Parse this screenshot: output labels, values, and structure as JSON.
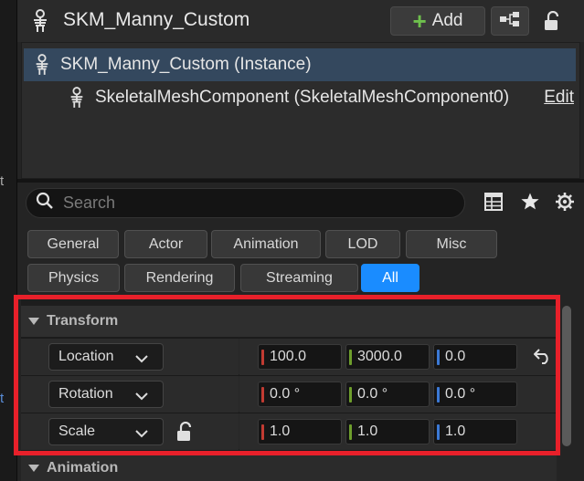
{
  "header": {
    "title": "SKM_Manny_Custom",
    "add_label": "Add",
    "icons": {
      "actor": "skeleton-icon",
      "add": "plus-icon",
      "tree": "hierarchy-icon",
      "lock": "unlock-icon"
    }
  },
  "tree": {
    "root_label": "SKM_Manny_Custom (Instance)",
    "child_label": "SkeletalMeshComponent (SkeletalMeshComponent0)",
    "edit_label": "Edit"
  },
  "search": {
    "placeholder": "Search"
  },
  "filters": {
    "row1": [
      "General",
      "Actor",
      "Animation",
      "LOD",
      "Misc"
    ],
    "row2": [
      "Physics",
      "Rendering",
      "Streaming",
      "All"
    ],
    "active": "All"
  },
  "transform": {
    "category": "Transform",
    "location": {
      "label": "Location",
      "x": "100.0",
      "y": "3000.0",
      "z": "0.0"
    },
    "rotation": {
      "label": "Rotation",
      "x": "0.0 °",
      "y": "0.0 °",
      "z": "0.0 °"
    },
    "scale": {
      "label": "Scale",
      "x": "1.0",
      "y": "1.0",
      "z": "1.0"
    }
  },
  "next_category": "Animation",
  "colors": {
    "accent": "#1a8cff",
    "selection": "#34485e",
    "highlight": "#e8202a",
    "axis_x": "#c23b32",
    "axis_y": "#6e9e2c",
    "axis_z": "#3b79d6",
    "add_plus": "#6ec04d"
  }
}
